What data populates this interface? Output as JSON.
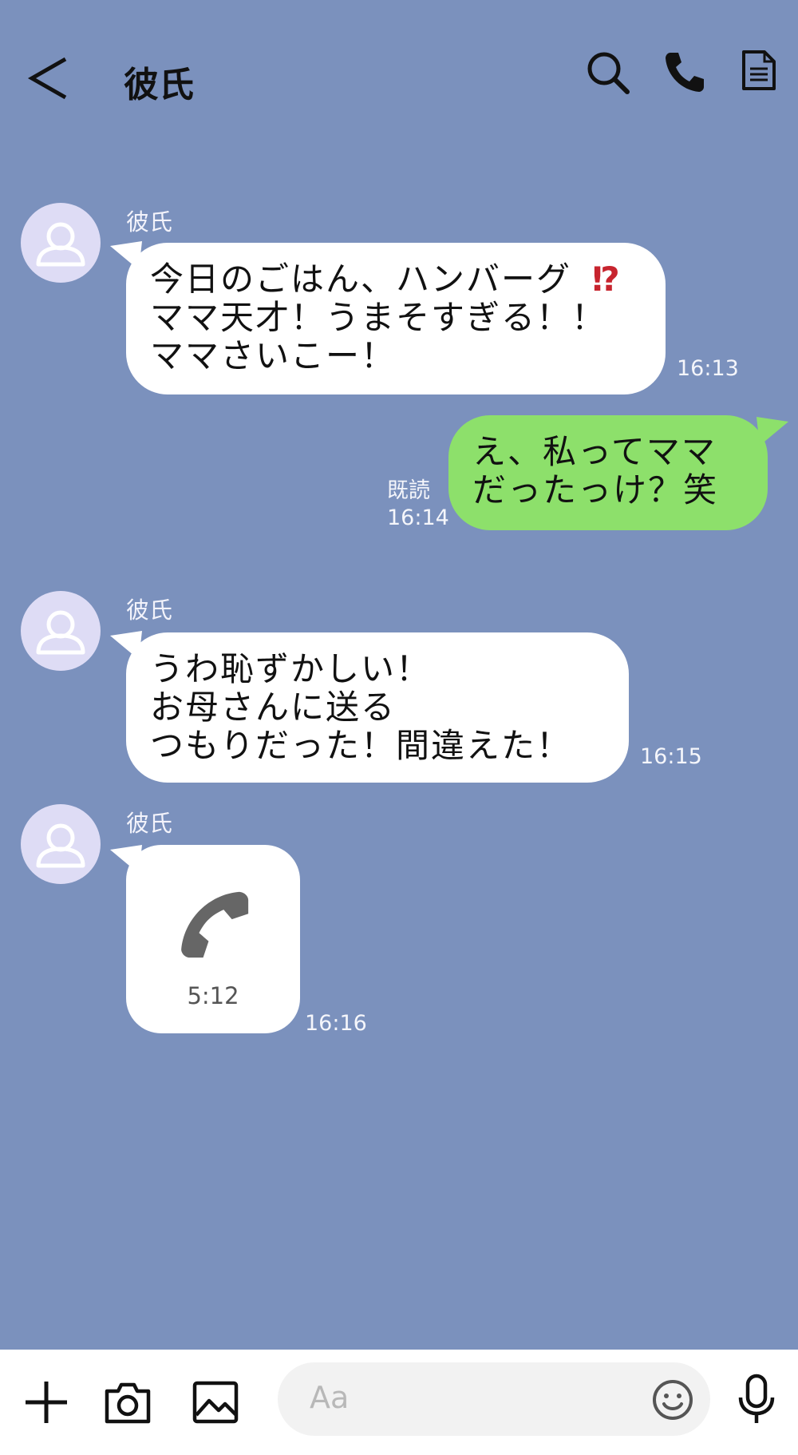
{
  "header": {
    "back_icon": "chevron-left-icon",
    "title": "彼氏",
    "search_icon": "search-icon",
    "call_icon": "phone-icon",
    "menu_icon": "document-icon"
  },
  "messages": [
    {
      "sender": "彼氏",
      "text_lines": "今日のごはん、ハンバーグ\nママ天才！うまそすぎる！！\nママさいこー！",
      "emoji": "⁉",
      "time": "16:13"
    },
    {
      "self": true,
      "text_lines": "え、私ってママ\nだったっけ？笑",
      "read_label": "既読",
      "time": "16:14"
    },
    {
      "sender": "彼氏",
      "text_lines": "うわ恥ずかしい！\nお母さんに送る\nつもりだった！間違えた！",
      "time": "16:15"
    },
    {
      "sender": "彼氏",
      "call": true,
      "call_duration": "5:12",
      "time": "16:16"
    }
  ],
  "input": {
    "placeholder": "Aa"
  },
  "toolbar_icons": [
    "plus-icon",
    "camera-icon",
    "image-icon",
    "emoji-icon",
    "microphone-icon"
  ],
  "colors": {
    "background": "#7b91bd",
    "self_bubble": "#8de06b",
    "other_bubble": "#ffffff",
    "avatar": "#dedcf5"
  }
}
